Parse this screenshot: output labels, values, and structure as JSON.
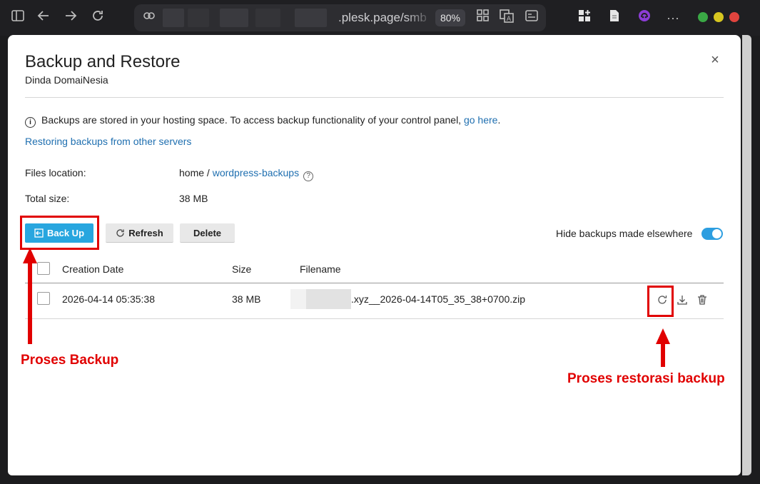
{
  "browser": {
    "url_text": ".plesk.page/smb",
    "zoom": "80%",
    "icons": [
      "sidebar-icon",
      "back-icon",
      "forward-icon",
      "reload-icon",
      "site-info-icon",
      "apps-icon",
      "translate-icon",
      "reader-icon",
      "extensions-icon",
      "notes-icon",
      "profile-icon",
      "more-icon"
    ],
    "window_colors": {
      "minimize": "#3aa845",
      "maximize": "#d7c620",
      "close": "#e0443e"
    }
  },
  "dialog": {
    "title": "Backup and Restore",
    "subtitle": "Dinda DomaiNesia",
    "close_label": "×",
    "info_text": "Backups are stored in your hosting space. To access backup functionality of your control panel, ",
    "info_link": "go here",
    "info_end": ".",
    "restore_link": "Restoring backups from other servers",
    "files_location_label": "Files location:",
    "files_location_home": "home / ",
    "files_location_folder": "wordpress-backups",
    "total_size_label": "Total size:",
    "total_size_value": "38 MB",
    "buttons": {
      "backup": "Back Up",
      "refresh": "Refresh",
      "delete": "Delete"
    },
    "hide_label": "Hide backups made elsewhere",
    "hide_toggle_on": true,
    "table": {
      "headers": {
        "date": "Creation Date",
        "size": "Size",
        "filename": "Filename"
      },
      "rows": [
        {
          "date": "2026-04-14 05:35:38",
          "size": "38 MB",
          "filename": ".xyz__2026-04-14T05_35_38+0700.zip"
        }
      ]
    }
  },
  "annotations": {
    "backup": "Proses Backup",
    "restore": "Proses restorasi backup",
    "color": "#e10000"
  }
}
